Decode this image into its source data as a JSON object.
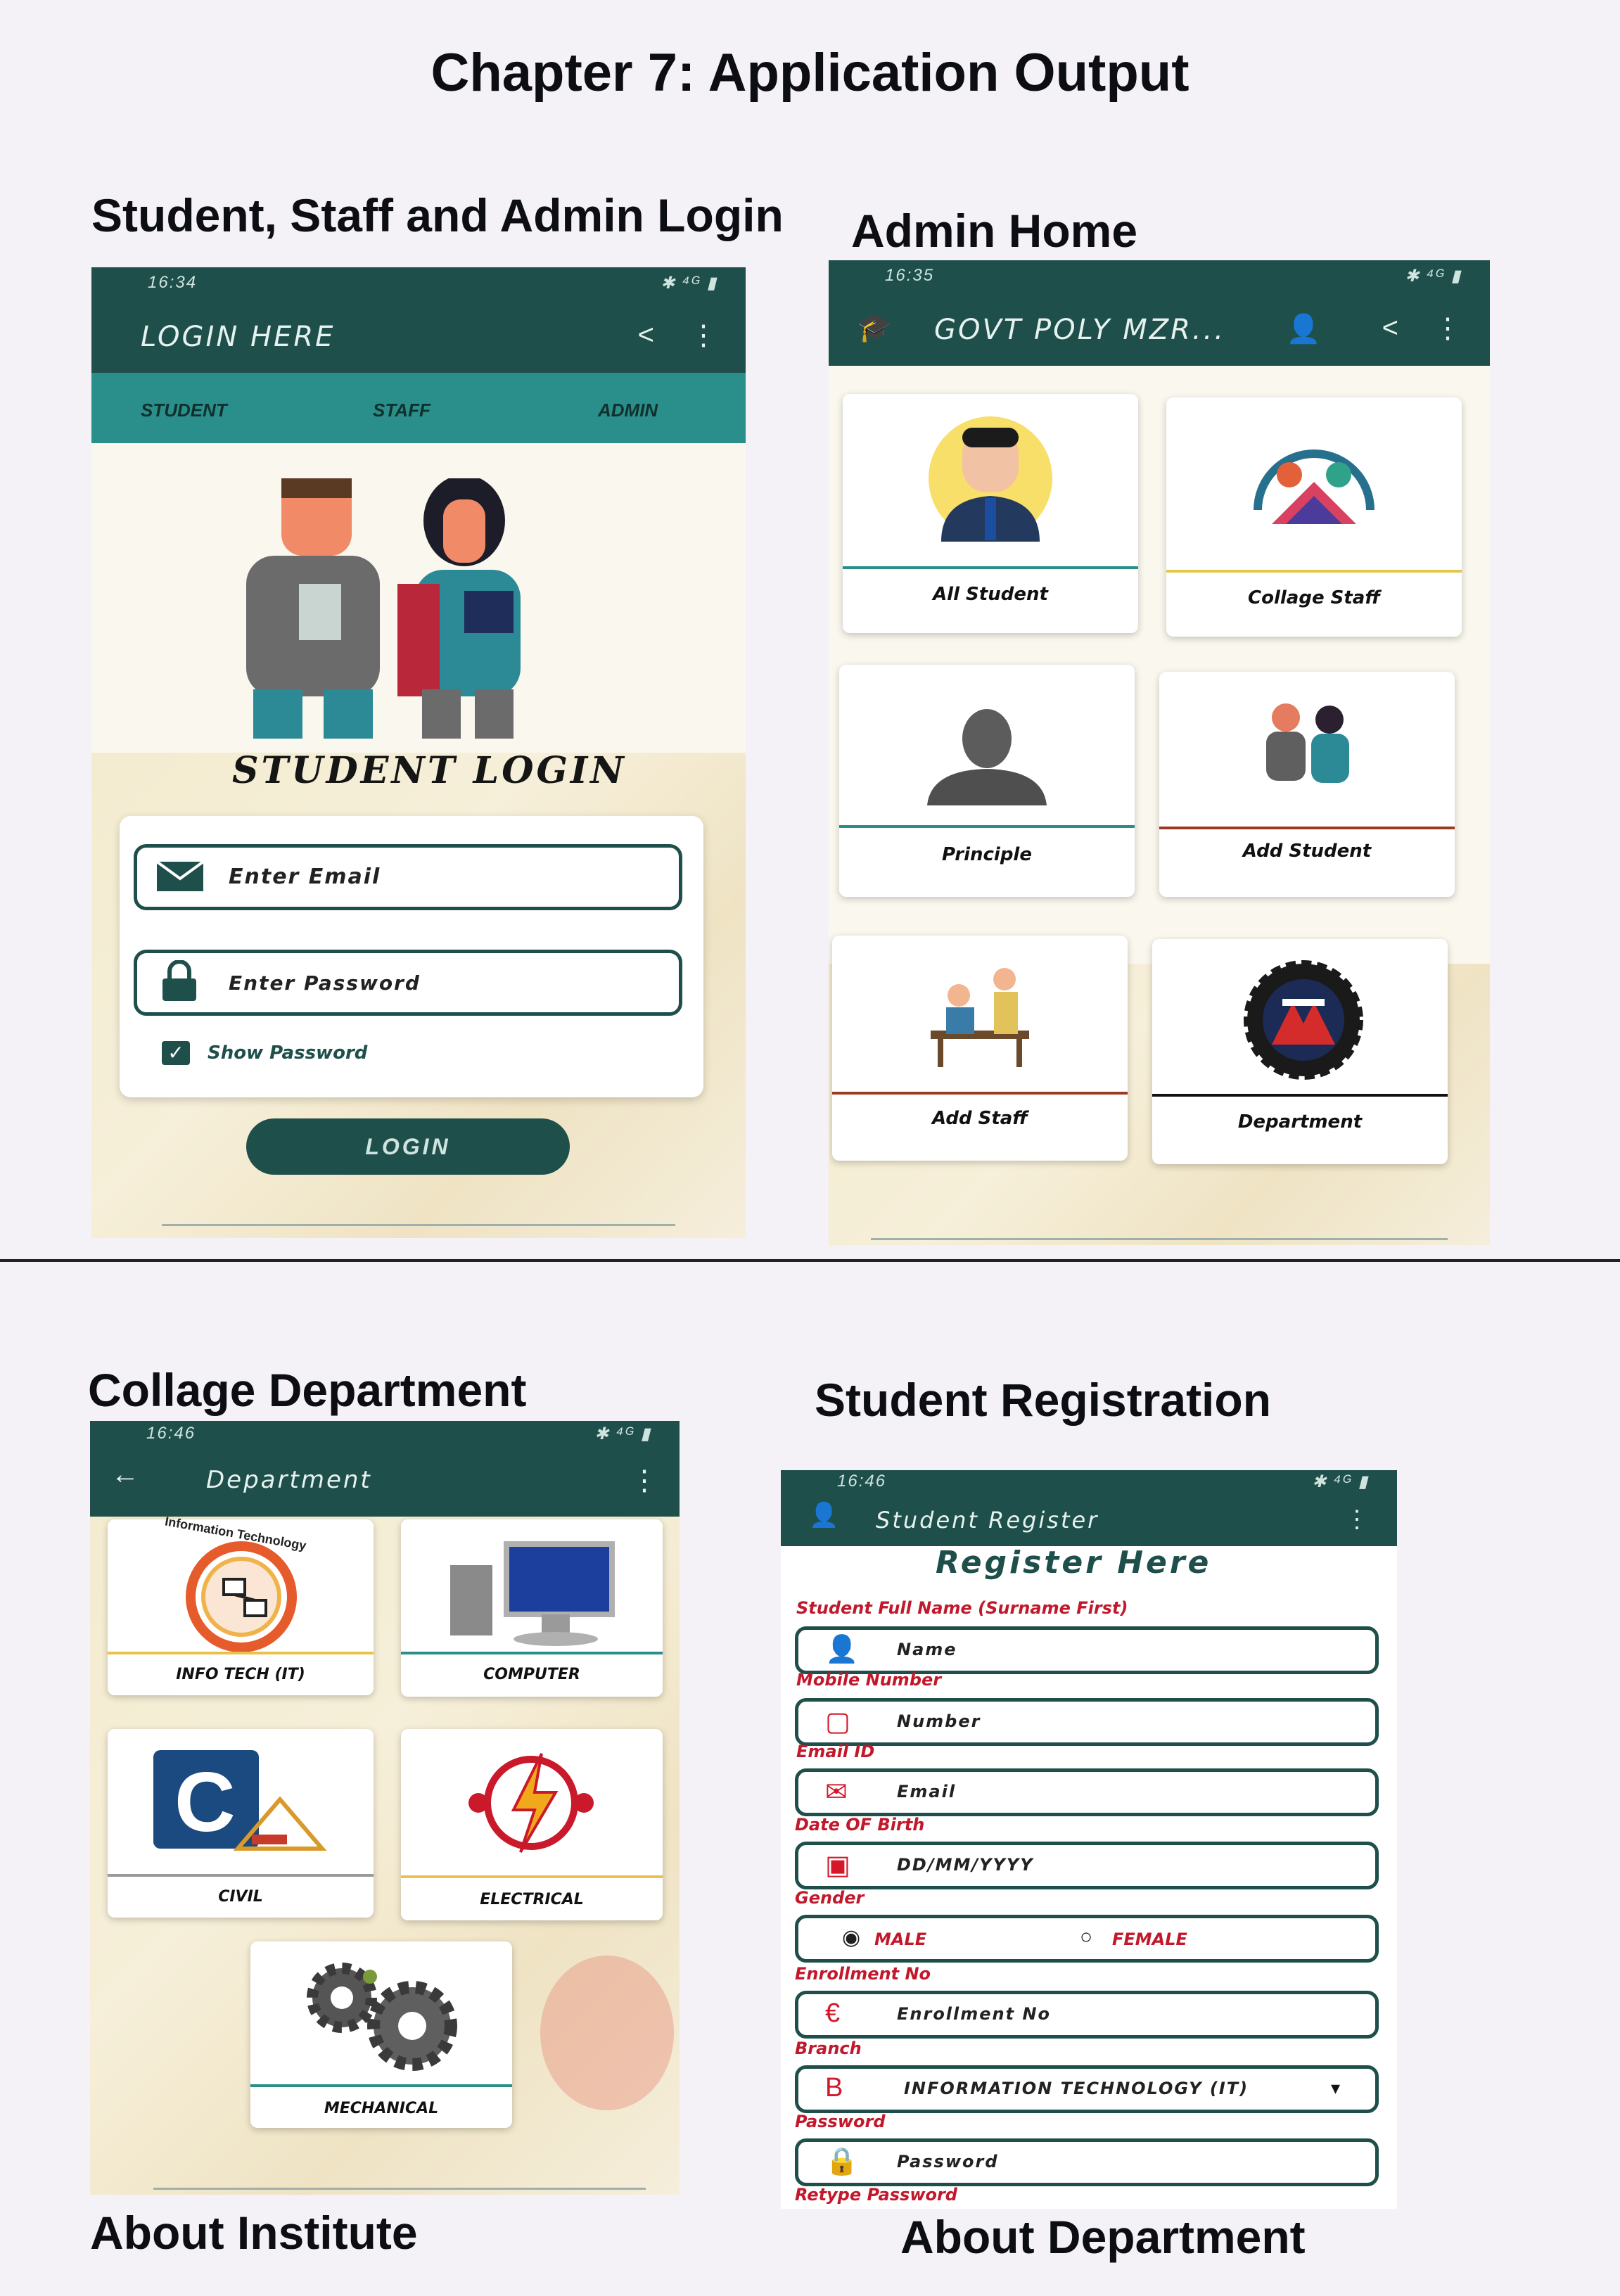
{
  "page": {
    "title": "Chapter 7: Application Output",
    "sections": {
      "login": "Student, Staff and Admin Login",
      "admin_home": "Admin Home",
      "department": "Collage Department",
      "registration": "Student Registration",
      "about_institute": "About Institute",
      "about_department": "About Department"
    }
  },
  "login_screen": {
    "time": "16:34",
    "status_icons": "✱ ⁴ᴳ ▮",
    "appbar_title": "LOGIN HERE",
    "tabs": [
      "STUDENT",
      "STAFF",
      "ADMIN"
    ],
    "heading": "STUDENT LOGIN",
    "email_placeholder": "Enter Email",
    "password_placeholder": "Enter Password",
    "show_password": "Show Password",
    "login_button": "LOGIN"
  },
  "admin_screen": {
    "time": "16:35",
    "appbar_title": "GOVT POLY MZR...",
    "tiles": [
      {
        "label": "All Student",
        "icon": "student-avatar-icon",
        "line": "#2a8f8a"
      },
      {
        "label": "Collage Staff",
        "icon": "staff-group-icon",
        "line": "#e3c845"
      },
      {
        "label": "Principle",
        "icon": "principal-silhouette-icon",
        "line": "#2a8f8a"
      },
      {
        "label": "Add Student",
        "icon": "add-student-icon",
        "line": "#9a3a22"
      },
      {
        "label": "Add Staff",
        "icon": "add-staff-icon",
        "line": "#9a3a22"
      },
      {
        "label": "Department",
        "icon": "department-emblem-icon",
        "line": "#111111"
      }
    ]
  },
  "department_screen": {
    "time": "16:46",
    "appbar_title": "Department",
    "tiles": [
      {
        "label": "INFO TECH (IT)",
        "icon": "info-tech-icon",
        "line": "#e8c24a",
        "badge": "Information Technology"
      },
      {
        "label": "COMPUTER",
        "icon": "computer-icon",
        "line": "#2a8f8a"
      },
      {
        "label": "CIVIL",
        "icon": "civil-icon",
        "line": "#9a9a9a"
      },
      {
        "label": "ELECTRICAL",
        "icon": "electrical-icon",
        "line": "#e8c24a"
      },
      {
        "label": "MECHANICAL",
        "icon": "mechanical-gears-icon",
        "line": "#2a8f8a"
      }
    ]
  },
  "register_screen": {
    "time": "16:46",
    "appbar_title": "Student Register",
    "heading": "Register Here",
    "fields": [
      {
        "label": "Student Full Name (Surname First)",
        "placeholder": "Name",
        "icon": "user-icon"
      },
      {
        "label": "Mobile Number",
        "placeholder": "Number",
        "icon": "phone-icon"
      },
      {
        "label": "Email ID",
        "placeholder": "Email",
        "icon": "mail-icon"
      },
      {
        "label": "Date OF Birth",
        "placeholder": "DD/MM/YYYY",
        "icon": "calendar-icon"
      }
    ],
    "gender_label": "Gender",
    "gender_options": [
      "MALE",
      "FEMALE"
    ],
    "enrollment_label": "Enrollment No",
    "enrollment_placeholder": "Enrollment No",
    "branch_label": "Branch",
    "branch_value": "INFORMATION TECHNOLOGY (IT)",
    "password_label": "Password",
    "password_placeholder": "Password",
    "retype_label": "Retype Password"
  },
  "colors": {
    "appbar": "#1f4f4b",
    "tabs": "#2a8f8a",
    "accent_red": "#d4182a"
  }
}
